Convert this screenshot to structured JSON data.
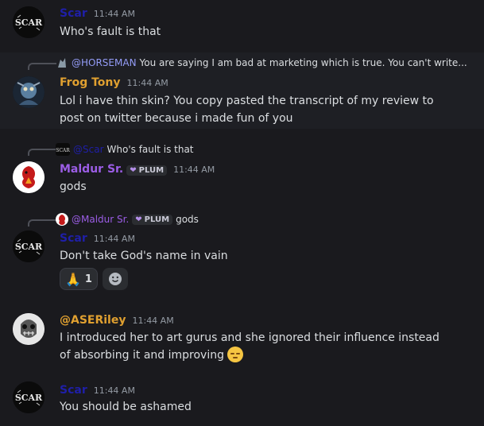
{
  "colors": {
    "scar": "#1f1fa8",
    "frog_tony": "#e0a030",
    "maldur": "#9b5de5",
    "aseriley": "#e0a030",
    "mention": "#949cf7",
    "background": "#1a1a1e"
  },
  "messages": [
    {
      "user": "Scar",
      "time": "11:44 AM",
      "text": "Who's fault is that",
      "avatar_icon": "scar-logo-icon"
    },
    {
      "reply": {
        "mention": "@HORSEMAN",
        "text": "You are saying I am bad at marketing which is true. You can't write..."
      },
      "user": "Frog Tony",
      "time": "11:44 AM",
      "text": "Lol i have thin skin? You copy pasted the transcript of my review to post on twitter because i made fun of you",
      "avatar_icon": "frog-warrior-icon"
    },
    {
      "reply": {
        "mention": "@Scar",
        "text": "Who's fault is that"
      },
      "user": "Maldur Sr.",
      "badge": "PLUM",
      "time": "11:44 AM",
      "text": "gods",
      "avatar_icon": "red-bird-icon"
    },
    {
      "reply": {
        "mention": "@Maldur Sr.",
        "badge": "PLUM",
        "text": "gods"
      },
      "user": "Scar",
      "time": "11:44 AM",
      "text": "Don't take God's name in vain",
      "reaction": {
        "emoji": "🙏",
        "count": "1",
        "icon": "praying-hands-icon"
      },
      "add_reaction_icon": "add-reaction-smiley-icon"
    },
    {
      "user": "@ASERiley",
      "time": "11:44 AM",
      "text": "I introduced her to art gurus and she ignored their influence instead of absorbing it and improving",
      "inline_emoji": "pensive-face-icon",
      "avatar_icon": "skull-mask-icon"
    },
    {
      "user": "Scar",
      "time": "11:44 AM",
      "text": "You should be ashamed",
      "avatar_icon": "scar-logo-icon"
    }
  ]
}
